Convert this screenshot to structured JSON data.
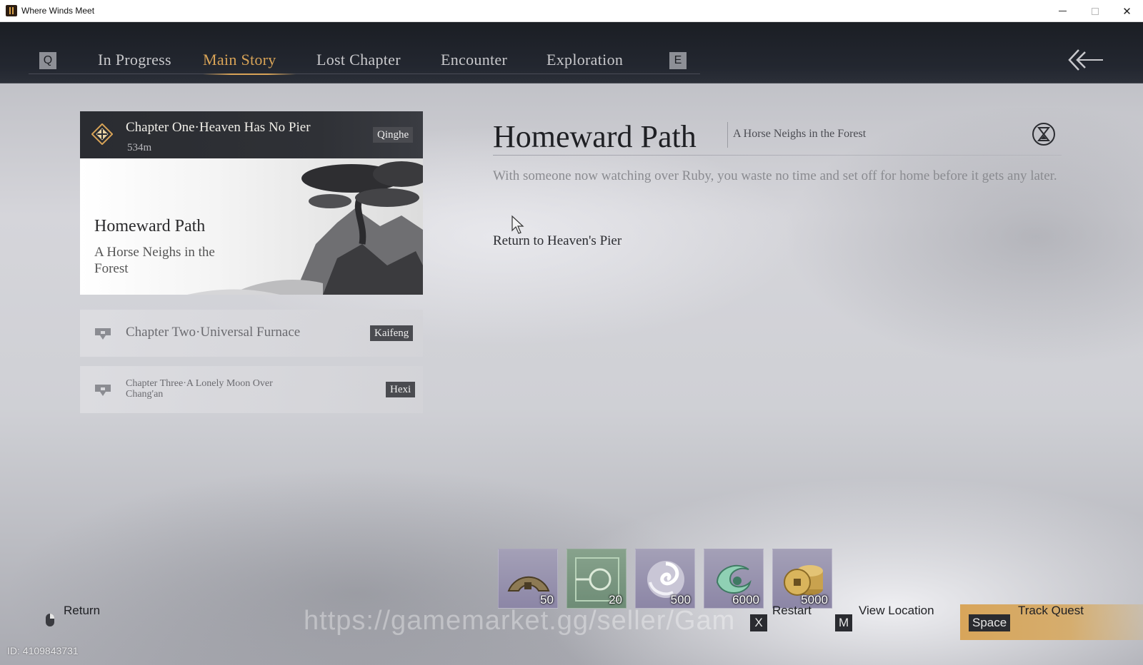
{
  "window": {
    "title": "Where Winds Meet"
  },
  "nav": {
    "prev_key": "Q",
    "next_key": "E",
    "tabs": [
      {
        "label": "In Progress",
        "active": false
      },
      {
        "label": "Main Story",
        "active": true
      },
      {
        "label": "Lost Chapter",
        "active": false
      },
      {
        "label": "Encounter",
        "active": false
      },
      {
        "label": "Exploration",
        "active": false
      }
    ],
    "back_icon": "double-chevron-left-arrow-icon"
  },
  "chapters": [
    {
      "title": "Chapter One·Heaven Has No Pier",
      "distance": "534m",
      "region": "Qinghe",
      "state": "active",
      "icon": "diamond-compass-icon",
      "quest_name": "Homeward Path",
      "quest_subtitle": "A Horse Neighs in the Forest"
    },
    {
      "title": "Chapter Two·Universal Furnace",
      "region": "Kaifeng",
      "state": "locked",
      "icon": "lock-icon"
    },
    {
      "title": "Chapter Three·A Lonely Moon Over Chang'an",
      "region": "Hexi",
      "state": "locked",
      "icon": "lock-icon"
    }
  ],
  "detail": {
    "title": "Homeward Path",
    "subtitle": "A Horse Neighs in the Forest",
    "description": "With someone now watching over Ruby, you waste no time and set off for home before it gets any later.",
    "objective": "Return to Heaven's Pier",
    "icon": "hourglass-icon"
  },
  "rewards": [
    {
      "icon": "bronze-coin-fragment-icon",
      "count": "50"
    },
    {
      "icon": "jade-map-token-icon",
      "count": "20"
    },
    {
      "icon": "swirl-essence-icon",
      "count": "500"
    },
    {
      "icon": "green-wind-crest-icon",
      "count": "6000"
    },
    {
      "icon": "gold-coins-stack-icon",
      "count": "5000"
    }
  ],
  "bottom": {
    "return_label": "Return",
    "restart_key": "X",
    "restart_label": "Restart",
    "view_key": "M",
    "view_label": "View Location",
    "track_key": "Space",
    "track_label": "Track Quest"
  },
  "overlay": {
    "watermark": "https://gamemarket.gg/seller/Gam",
    "uid": "ID: 4109843731"
  },
  "colors": {
    "accent_gold": "#d8a357",
    "nav_bg": "#1b1e24",
    "reward_purple": "#8c86a6",
    "reward_green": "#6e8c76"
  }
}
